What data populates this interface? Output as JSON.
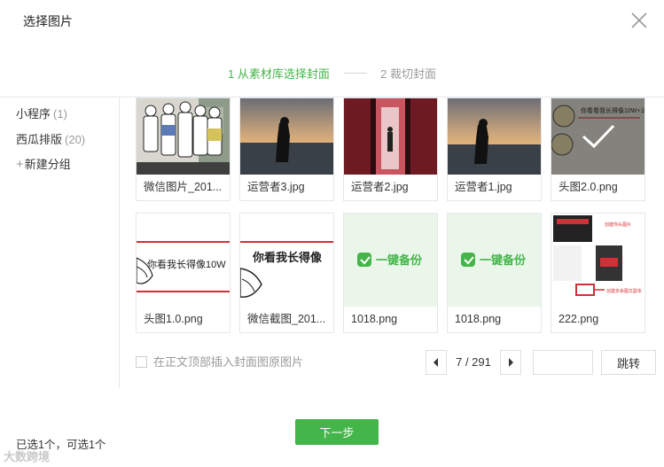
{
  "dialog": {
    "title": "选择图片"
  },
  "steps": {
    "step1": "1 从素材库选择封面",
    "step2": "2 裁切封面"
  },
  "sidebar": {
    "items": [
      {
        "label": "小程序",
        "count": "(1)"
      },
      {
        "label": "西瓜排版",
        "count": "(20)"
      }
    ],
    "add_label": "新建分组"
  },
  "images": [
    {
      "name": "微信图片_201...",
      "selected": false
    },
    {
      "name": "运营者3.jpg",
      "selected": false
    },
    {
      "name": "运营者2.jpg",
      "selected": false
    },
    {
      "name": "运营者1.jpg",
      "selected": false
    },
    {
      "name": "头图2.0.png",
      "selected": true
    },
    {
      "name": "头图1.0.png",
      "selected": false
    },
    {
      "name": "微信截图_201...",
      "selected": false
    },
    {
      "name": "1018.png",
      "selected": false
    },
    {
      "name": "1018.png",
      "selected": false
    },
    {
      "name": "222.png",
      "selected": false
    }
  ],
  "thumb_text": {
    "meme_question": "你看看我长得像10W+么?",
    "headline": "你看我长得像10W",
    "headline_short": "你看我长得像",
    "backup": "一键备份",
    "ann1": "创建你头图片",
    "ann2": "创建多余图文副本"
  },
  "options": {
    "insert_cover_label": "在正文顶部插入封面图原图片"
  },
  "pagination": {
    "text": "7 / 291",
    "jump_label": "跳转",
    "page_input_value": ""
  },
  "footer": {
    "status": "已选1个，可选1个",
    "next_label": "下一步",
    "watermark": "大数跨境"
  },
  "colors": {
    "accent": "#44b549",
    "border": "#e4e8eb",
    "muted": "#9a9a9a"
  }
}
